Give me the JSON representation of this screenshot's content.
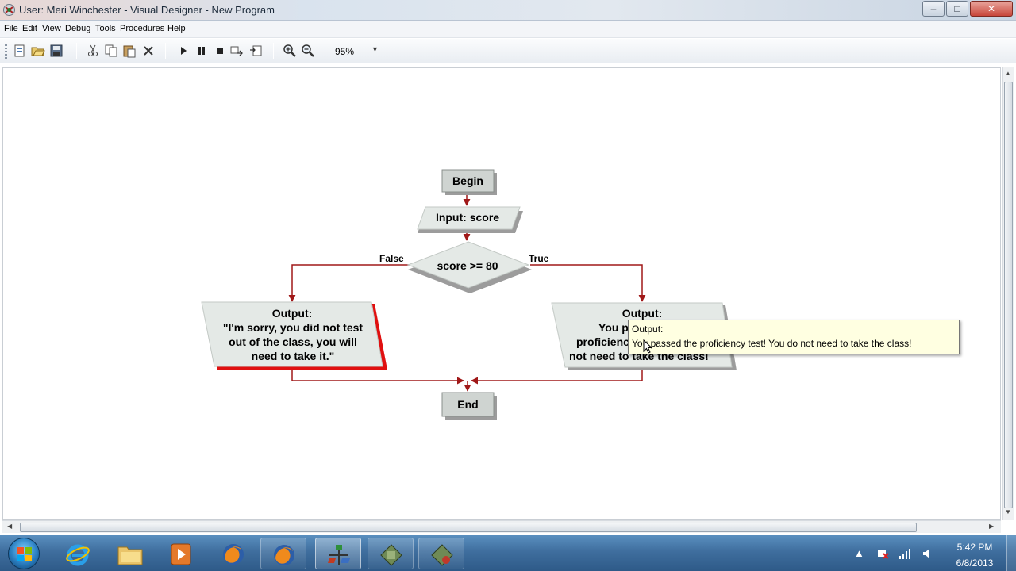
{
  "window": {
    "title": "User: Meri Winchester - Visual Designer - New Program",
    "controls": {
      "minimize": "–",
      "maximize": "□",
      "close": "✕"
    }
  },
  "menu": {
    "items": [
      "File",
      "Edit",
      "View",
      "Debug",
      "Tools",
      "Procedures",
      "Help"
    ]
  },
  "toolbar": {
    "buttons": [
      "new-icon",
      "open-icon",
      "save-icon",
      "cut-icon",
      "copy-icon",
      "paste-icon",
      "delete-icon",
      "run-icon",
      "pause-icon",
      "stop-icon",
      "step-icon",
      "step-over-icon",
      "zoom-in-icon",
      "zoom-out-icon"
    ],
    "zoom_value": "95%"
  },
  "flowchart": {
    "begin": "Begin",
    "input": "Input: score",
    "decision": "score >= 80",
    "false_label": "False",
    "true_label": "True",
    "output_false": {
      "title": "Output:",
      "text": "\"I'm sorry, you did not test out of the class, you will need to take it.\""
    },
    "output_true": {
      "title": "Output:",
      "line1": "You p",
      "line2": "proficienc",
      "line3": "not need to take the class!"
    },
    "end": "End",
    "colors": {
      "connector": "#a01818",
      "node_fill": "#e4e9e6",
      "shadow": "#9c9c9c",
      "selected": "#e01010"
    }
  },
  "tooltip": {
    "title": "Output:",
    "body": "You passed the proficiency test! You do not need to take the class!"
  },
  "taskbar": {
    "apps": [
      "internet-explorer-icon",
      "file-explorer-icon",
      "media-player-icon",
      "firefox-icon",
      "firefox-icon",
      "visual-designer-icon",
      "app-icon",
      "app-icon"
    ],
    "clock_time": "5:42 PM",
    "clock_date": "6/8/2013"
  }
}
